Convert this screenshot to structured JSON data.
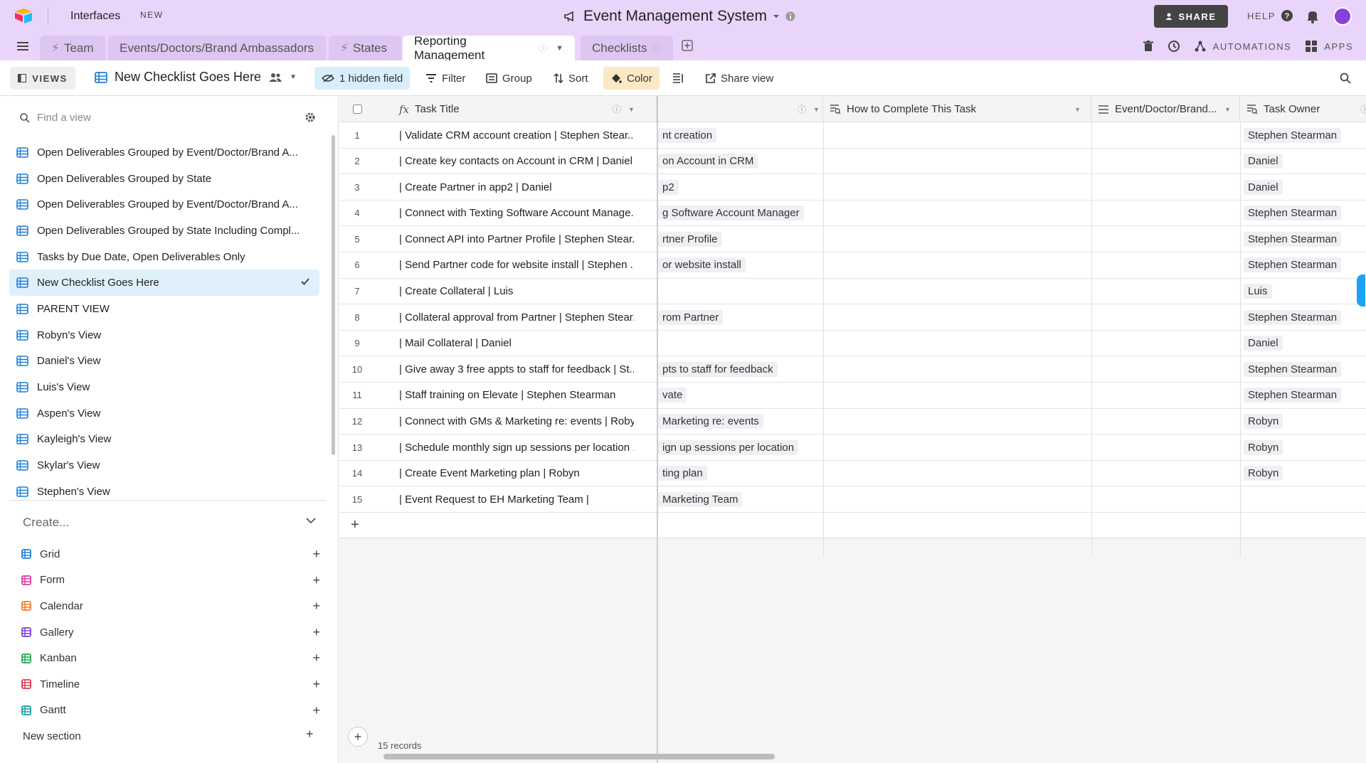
{
  "topbar": {
    "interfaces": "Interfaces",
    "new_badge": "NEW",
    "base_title": "Event Management System",
    "share": "SHARE",
    "help": "HELP"
  },
  "tabs": [
    {
      "label": "Team"
    },
    {
      "label": "Events/Doctors/Brand Ambassadors"
    },
    {
      "label": "States"
    },
    {
      "label": "Reporting Management"
    },
    {
      "label": "Checklists"
    }
  ],
  "tabbar_right": {
    "automations": "AUTOMATIONS",
    "apps": "APPS"
  },
  "toolbar": {
    "views": "VIEWS",
    "view_name": "New Checklist Goes Here",
    "hidden_field": "1 hidden field",
    "filter": "Filter",
    "group": "Group",
    "sort": "Sort",
    "color": "Color",
    "share_view": "Share view"
  },
  "sidebar": {
    "find_placeholder": "Find a view",
    "views": [
      "Open Deliverables Grouped by Event/Doctor/Brand A...",
      "Open Deliverables Grouped by State",
      "Open Deliverables Grouped by Event/Doctor/Brand A...",
      "Open Deliverables Grouped by State Including Compl...",
      "Tasks by Due Date, Open Deliverables Only",
      "New Checklist Goes Here",
      "PARENT VIEW",
      "Robyn's View",
      "Daniel's View",
      "Luis's View",
      "Aspen's View",
      "Kayleigh's View",
      "Skylar's View",
      "Stephen's View"
    ],
    "create": "Create...",
    "create_items": [
      {
        "label": "Grid",
        "color": "#1f7fd9"
      },
      {
        "label": "Form",
        "color": "#e0399b"
      },
      {
        "label": "Calendar",
        "color": "#f07a2a"
      },
      {
        "label": "Gallery",
        "color": "#7c3fd8"
      },
      {
        "label": "Kanban",
        "color": "#20a84a"
      },
      {
        "label": "Timeline",
        "color": "#e0384f"
      },
      {
        "label": "Gantt",
        "color": "#14a0a0"
      }
    ],
    "new_section": "New section"
  },
  "grid": {
    "headers": {
      "task_title": "Task Title",
      "how_to": "How to Complete This Task",
      "event": "Event/Doctor/Brand...",
      "owner": "Task Owner"
    },
    "rows": [
      {
        "n": "1",
        "title": "| Validate CRM account creation | Stephen Stear...",
        "hidden": "nt creation",
        "owner": "Stephen Stearman"
      },
      {
        "n": "2",
        "title": "| Create key contacts on Account in CRM | Daniel",
        "hidden": "on Account in CRM",
        "owner": "Daniel"
      },
      {
        "n": "3",
        "title": "| Create Partner in app2 | Daniel",
        "hidden": "p2",
        "owner": "Daniel"
      },
      {
        "n": "4",
        "title": "| Connect with Texting Software Account Manage...",
        "hidden": "g Software Account Manager",
        "owner": "Stephen Stearman"
      },
      {
        "n": "5",
        "title": "| Connect API into Partner Profile | Stephen Stear...",
        "hidden": "rtner Profile",
        "owner": "Stephen Stearman"
      },
      {
        "n": "6",
        "title": "| Send Partner code for website install | Stephen ...",
        "hidden": "or website install",
        "owner": "Stephen Stearman"
      },
      {
        "n": "7",
        "title": "| Create Collateral | Luis",
        "hidden": "",
        "owner": "Luis"
      },
      {
        "n": "8",
        "title": "| Collateral approval from Partner | Stephen Stear...",
        "hidden": "rom Partner",
        "owner": "Stephen Stearman"
      },
      {
        "n": "9",
        "title": "| Mail Collateral | Daniel",
        "hidden": "",
        "owner": "Daniel"
      },
      {
        "n": "10",
        "title": "| Give away 3 free appts to staff for feedback | St...",
        "hidden": "pts to staff for feedback",
        "owner": "Stephen Stearman"
      },
      {
        "n": "11",
        "title": "| Staff training on Elevate | Stephen Stearman",
        "hidden": "vate",
        "owner": "Stephen Stearman"
      },
      {
        "n": "12",
        "title": "| Connect with GMs & Marketing re: events | Robyn",
        "hidden": "Marketing re: events",
        "owner": "Robyn"
      },
      {
        "n": "13",
        "title": "| Schedule monthly sign up sessions per location ...",
        "hidden": "ign up sessions per location",
        "owner": "Robyn"
      },
      {
        "n": "14",
        "title": "| Create Event Marketing plan | Robyn",
        "hidden": "ting plan",
        "owner": "Robyn"
      },
      {
        "n": "15",
        "title": "| Event Request to EH Marketing Team |",
        "hidden": "Marketing Team",
        "owner": ""
      }
    ],
    "records": "15 records"
  }
}
